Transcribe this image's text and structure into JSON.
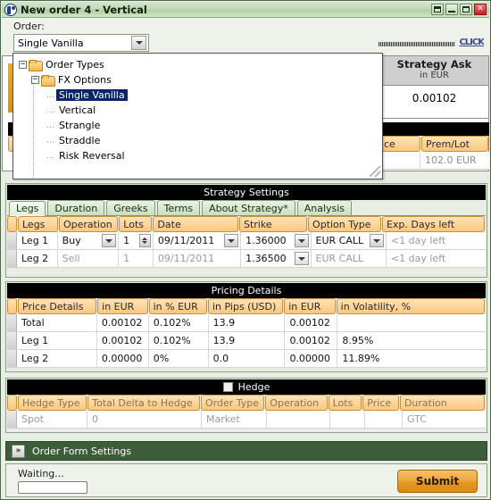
{
  "window": {
    "title": "New order 4 - Vertical",
    "icon": "app-icon",
    "buttons": {
      "shade": "shade",
      "minimize": "minimize",
      "maximize": "maximize",
      "close": "✕"
    }
  },
  "order": {
    "label": "Order:",
    "selected": "Single Vanilla",
    "watermark": "CLICK"
  },
  "tree": {
    "root": "Order Types",
    "group": "FX Options",
    "items": [
      {
        "label": "Single Vanilla",
        "selected": true
      },
      {
        "label": "Vertical",
        "selected": false
      },
      {
        "label": "Strangle",
        "selected": false
      },
      {
        "label": "Straddle",
        "selected": false
      },
      {
        "label": "Risk Reversal",
        "selected": false
      }
    ]
  },
  "strategy_ask": {
    "title": "Strategy Ask",
    "subtitle": "in EUR",
    "value": "0.00102"
  },
  "background_table": {
    "headers": [
      "ce",
      "Prem/Lot"
    ],
    "row": [
      "",
      "102.0 EUR"
    ]
  },
  "strategy_settings": {
    "title": "Strategy Settings",
    "tabs": [
      {
        "label": "Legs",
        "active": true
      },
      {
        "label": "Duration",
        "active": false
      },
      {
        "label": "Greeks",
        "active": false
      },
      {
        "label": "Terms",
        "active": false
      },
      {
        "label": "About Strategy*",
        "active": false
      },
      {
        "label": "Analysis",
        "active": false
      }
    ],
    "columns": [
      "Legs",
      "Operation",
      "Lots",
      "Date",
      "Strike",
      "Option Type",
      "Exp. Days left"
    ],
    "rows": [
      {
        "leg": "Leg 1",
        "operation": "Buy",
        "lots": "1",
        "date": "09/11/2011",
        "strike": "1.36000",
        "option_type": "EUR CALL",
        "exp_days_left": "<1 day left",
        "enabled": true
      },
      {
        "leg": "Leg 2",
        "operation": "Sell",
        "lots": "1",
        "date": "09/11/2011",
        "strike": "1.36500",
        "option_type": "EUR CALL",
        "exp_days_left": "<1 day left",
        "enabled": false
      }
    ]
  },
  "pricing_details": {
    "title": "Pricing Details",
    "columns": [
      "Price Details",
      "in EUR",
      "in % EUR",
      "in Pips (USD)",
      "in EUR",
      "in Volatility, %"
    ],
    "rows": [
      {
        "name": "Total",
        "in_eur": "0.00102",
        "in_pct_eur": "0.102%",
        "in_pips_usd": "13.9",
        "in_eur_2": "0.00102",
        "in_vol": ""
      },
      {
        "name": "Leg 1",
        "in_eur": "0.00102",
        "in_pct_eur": "0.102%",
        "in_pips_usd": "13.9",
        "in_eur_2": "0.00102",
        "in_vol": "8.95%"
      },
      {
        "name": "Leg 2",
        "in_eur": "0.00000",
        "in_pct_eur": "0%",
        "in_pips_usd": "0.0",
        "in_eur_2": "0.00000",
        "in_vol": "11.89%"
      }
    ]
  },
  "hedge": {
    "title": "Hedge",
    "checked": false,
    "columns": [
      "Hedge Type",
      "Total Delta to Hedge",
      "Order Type",
      "Operation",
      "Lots",
      "Price",
      "Duration"
    ],
    "rows": [
      {
        "hedge_type": "Spot",
        "total_delta": "0",
        "order_type": "Market",
        "operation": "",
        "lots": "",
        "price": "",
        "duration": "GTC"
      }
    ]
  },
  "order_form_settings": {
    "label": "Order Form Settings",
    "expander": "»"
  },
  "footer": {
    "status": "Waiting...",
    "progress_value": "",
    "submit_label": "Submit"
  },
  "colors": {
    "accent_orange": "#fbc77e",
    "title_green": "#c2d9b6",
    "panel_black": "#000000",
    "submit_orange": "#e49a22",
    "selection_blue": "#0a246a",
    "dark_green_bar": "#3d5c3a"
  }
}
